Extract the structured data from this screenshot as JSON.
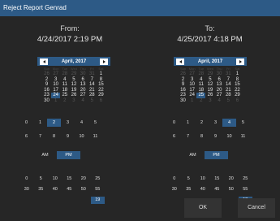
{
  "window": {
    "title": "Reject Report Genrad"
  },
  "from": {
    "caption": "From:",
    "datetime": "4/24/2017 2:19 PM",
    "calendar": {
      "month_label": "April, 2017",
      "days_of_week": [
        "Sun",
        "Mon",
        "Tue",
        "Wed",
        "Thu",
        "Fri",
        "Sat"
      ],
      "weeks": [
        [
          {
            "d": "26",
            "dim": true
          },
          {
            "d": "27",
            "dim": true
          },
          {
            "d": "28",
            "dim": true
          },
          {
            "d": "29",
            "dim": true
          },
          {
            "d": "30",
            "dim": true
          },
          {
            "d": "31",
            "dim": true
          },
          {
            "d": "1"
          }
        ],
        [
          {
            "d": "2"
          },
          {
            "d": "3"
          },
          {
            "d": "4"
          },
          {
            "d": "5"
          },
          {
            "d": "6"
          },
          {
            "d": "7"
          },
          {
            "d": "8"
          }
        ],
        [
          {
            "d": "9"
          },
          {
            "d": "10"
          },
          {
            "d": "11"
          },
          {
            "d": "12"
          },
          {
            "d": "13"
          },
          {
            "d": "14"
          },
          {
            "d": "15"
          }
        ],
        [
          {
            "d": "16"
          },
          {
            "d": "17"
          },
          {
            "d": "18"
          },
          {
            "d": "19"
          },
          {
            "d": "20"
          },
          {
            "d": "21"
          },
          {
            "d": "22"
          }
        ],
        [
          {
            "d": "23"
          },
          {
            "d": "24",
            "sel": true
          },
          {
            "d": "25"
          },
          {
            "d": "26"
          },
          {
            "d": "27"
          },
          {
            "d": "28"
          },
          {
            "d": "29"
          }
        ],
        [
          {
            "d": "30"
          },
          {
            "d": "1",
            "dim": true
          },
          {
            "d": "2",
            "dim": true
          },
          {
            "d": "3",
            "dim": true
          },
          {
            "d": "4",
            "dim": true
          },
          {
            "d": "5",
            "dim": true
          },
          {
            "d": "6",
            "dim": true
          }
        ]
      ]
    },
    "hours": [
      [
        "0",
        "1",
        "2",
        "3",
        "4",
        "5"
      ],
      [
        "6",
        "7",
        "8",
        "9",
        "10",
        "11"
      ]
    ],
    "selected_hour": "2",
    "ampm": [
      "AM",
      "PM"
    ],
    "selected_ampm": "PM",
    "minutes": [
      [
        "0",
        "5",
        "10",
        "15",
        "20",
        "25"
      ],
      [
        "30",
        "35",
        "40",
        "45",
        "50",
        "55"
      ],
      [
        "",
        "",
        "",
        "",
        "",
        "19"
      ]
    ],
    "selected_minute": "19"
  },
  "to": {
    "caption": "To:",
    "datetime": "4/25/2017 4:18 PM",
    "calendar": {
      "month_label": "April, 2017",
      "days_of_week": [
        "Sun",
        "Mon",
        "Tue",
        "Wed",
        "Thu",
        "Fri",
        "Sat"
      ],
      "weeks": [
        [
          {
            "d": "26",
            "dim": true
          },
          {
            "d": "27",
            "dim": true
          },
          {
            "d": "28",
            "dim": true
          },
          {
            "d": "29",
            "dim": true
          },
          {
            "d": "30",
            "dim": true
          },
          {
            "d": "31",
            "dim": true
          },
          {
            "d": "1"
          }
        ],
        [
          {
            "d": "2"
          },
          {
            "d": "3"
          },
          {
            "d": "4"
          },
          {
            "d": "5"
          },
          {
            "d": "6"
          },
          {
            "d": "7"
          },
          {
            "d": "8"
          }
        ],
        [
          {
            "d": "9"
          },
          {
            "d": "10"
          },
          {
            "d": "11"
          },
          {
            "d": "12"
          },
          {
            "d": "13"
          },
          {
            "d": "14"
          },
          {
            "d": "15"
          }
        ],
        [
          {
            "d": "16"
          },
          {
            "d": "17"
          },
          {
            "d": "18"
          },
          {
            "d": "19"
          },
          {
            "d": "20"
          },
          {
            "d": "21"
          },
          {
            "d": "22"
          }
        ],
        [
          {
            "d": "23"
          },
          {
            "d": "24"
          },
          {
            "d": "25",
            "sel": true
          },
          {
            "d": "26"
          },
          {
            "d": "27"
          },
          {
            "d": "28"
          },
          {
            "d": "29"
          }
        ],
        [
          {
            "d": "30"
          },
          {
            "d": "1",
            "dim": true
          },
          {
            "d": "2",
            "dim": true
          },
          {
            "d": "3",
            "dim": true
          },
          {
            "d": "4",
            "dim": true
          },
          {
            "d": "5",
            "dim": true
          },
          {
            "d": "6",
            "dim": true
          }
        ]
      ]
    },
    "hours": [
      [
        "0",
        "1",
        "2",
        "3",
        "4",
        "5"
      ],
      [
        "6",
        "7",
        "8",
        "9",
        "10",
        "11"
      ]
    ],
    "selected_hour": "4",
    "ampm": [
      "AM",
      "PM"
    ],
    "selected_ampm": "PM",
    "minutes": [
      [
        "0",
        "5",
        "10",
        "15",
        "20",
        "25"
      ],
      [
        "30",
        "35",
        "40",
        "45",
        "50",
        "55"
      ],
      [
        "",
        "",
        "",
        "",
        "",
        "18"
      ]
    ],
    "selected_minute": "18"
  },
  "buttons": {
    "ok_label": "OK",
    "cancel_label": "Cancel"
  },
  "colors": {
    "accent": "#2d5a86",
    "background": "#262626",
    "button": "#333333"
  }
}
